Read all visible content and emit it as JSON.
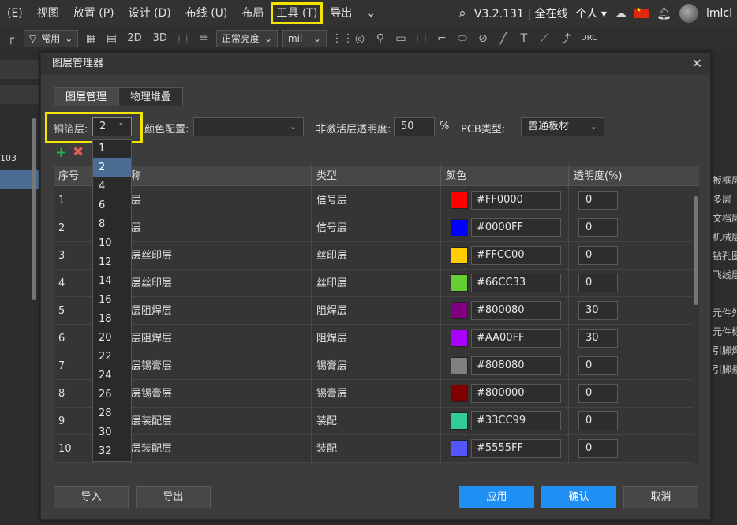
{
  "menubar": {
    "items": [
      "(E)",
      "视图",
      "放置 (P)",
      "设计 (D)",
      "布线 (U)",
      "布局",
      "工具 (T)",
      "导出",
      "⌄"
    ],
    "version": "V3.2.131 | 全在线",
    "account": "个人",
    "username": "lmlcl"
  },
  "toolbar": {
    "filter_label": "常用",
    "view_2d": "2D",
    "view_3d": "3D",
    "brightness_label": "正常亮度",
    "unit_label": "mil",
    "drc_label": "DRC"
  },
  "left_panel": {
    "number": "103"
  },
  "right_panel": {
    "labels": [
      "板框层",
      "多层",
      "文档层",
      "机械层",
      "钻孔图层",
      "飞线层",
      "元件外形",
      "元件标识",
      "引脚焊盘",
      "引脚悬空"
    ]
  },
  "dialog": {
    "title": "图层管理器",
    "tabs": [
      "图层管理",
      "物理堆叠"
    ],
    "copper_label": "铜箔层:",
    "copper_value": "2",
    "color_config_label": "颜色配置:",
    "color_config_value": "",
    "inactive_opacity_label": "非激活层透明度:",
    "inactive_opacity_value": "50",
    "percent": "%",
    "pcb_type_label": "PCB类型:",
    "pcb_type_value": "普通板材",
    "columns": [
      "序号",
      "称",
      "类型",
      "颜色",
      "透明度(%)"
    ],
    "rows": [
      {
        "no": "1",
        "name": "层",
        "type": "信号层",
        "color": "#FF0000",
        "opacity": "0"
      },
      {
        "no": "2",
        "name": "层",
        "type": "信号层",
        "color": "#0000FF",
        "opacity": "0"
      },
      {
        "no": "3",
        "name": "层丝印层",
        "type": "丝印层",
        "color": "#FFCC00",
        "opacity": "0"
      },
      {
        "no": "4",
        "name": "层丝印层",
        "type": "丝印层",
        "color": "#66CC33",
        "opacity": "0"
      },
      {
        "no": "5",
        "name": "层阻焊层",
        "type": "阻焊层",
        "color": "#800080",
        "opacity": "30"
      },
      {
        "no": "6",
        "name": "层阻焊层",
        "type": "阻焊层",
        "color": "#AA00FF",
        "opacity": "30"
      },
      {
        "no": "7",
        "name": "层锡膏层",
        "type": "锡膏层",
        "color": "#808080",
        "opacity": "0"
      },
      {
        "no": "8",
        "name": "层锡膏层",
        "type": "锡膏层",
        "color": "#800000",
        "opacity": "0"
      },
      {
        "no": "9",
        "name": "层装配层",
        "type": "装配",
        "color": "#33CC99",
        "opacity": "0"
      },
      {
        "no": "10",
        "name": "层装配层",
        "type": "装配",
        "color": "#5555FF",
        "opacity": "0"
      }
    ],
    "copper_options": [
      "1",
      "2",
      "4",
      "6",
      "8",
      "10",
      "12",
      "14",
      "16",
      "18",
      "20",
      "22",
      "24",
      "26",
      "28",
      "30",
      "32"
    ],
    "copper_selected": "2",
    "buttons": {
      "import": "导入",
      "export": "导出",
      "apply": "应用",
      "confirm": "确认",
      "cancel": "取消"
    }
  }
}
